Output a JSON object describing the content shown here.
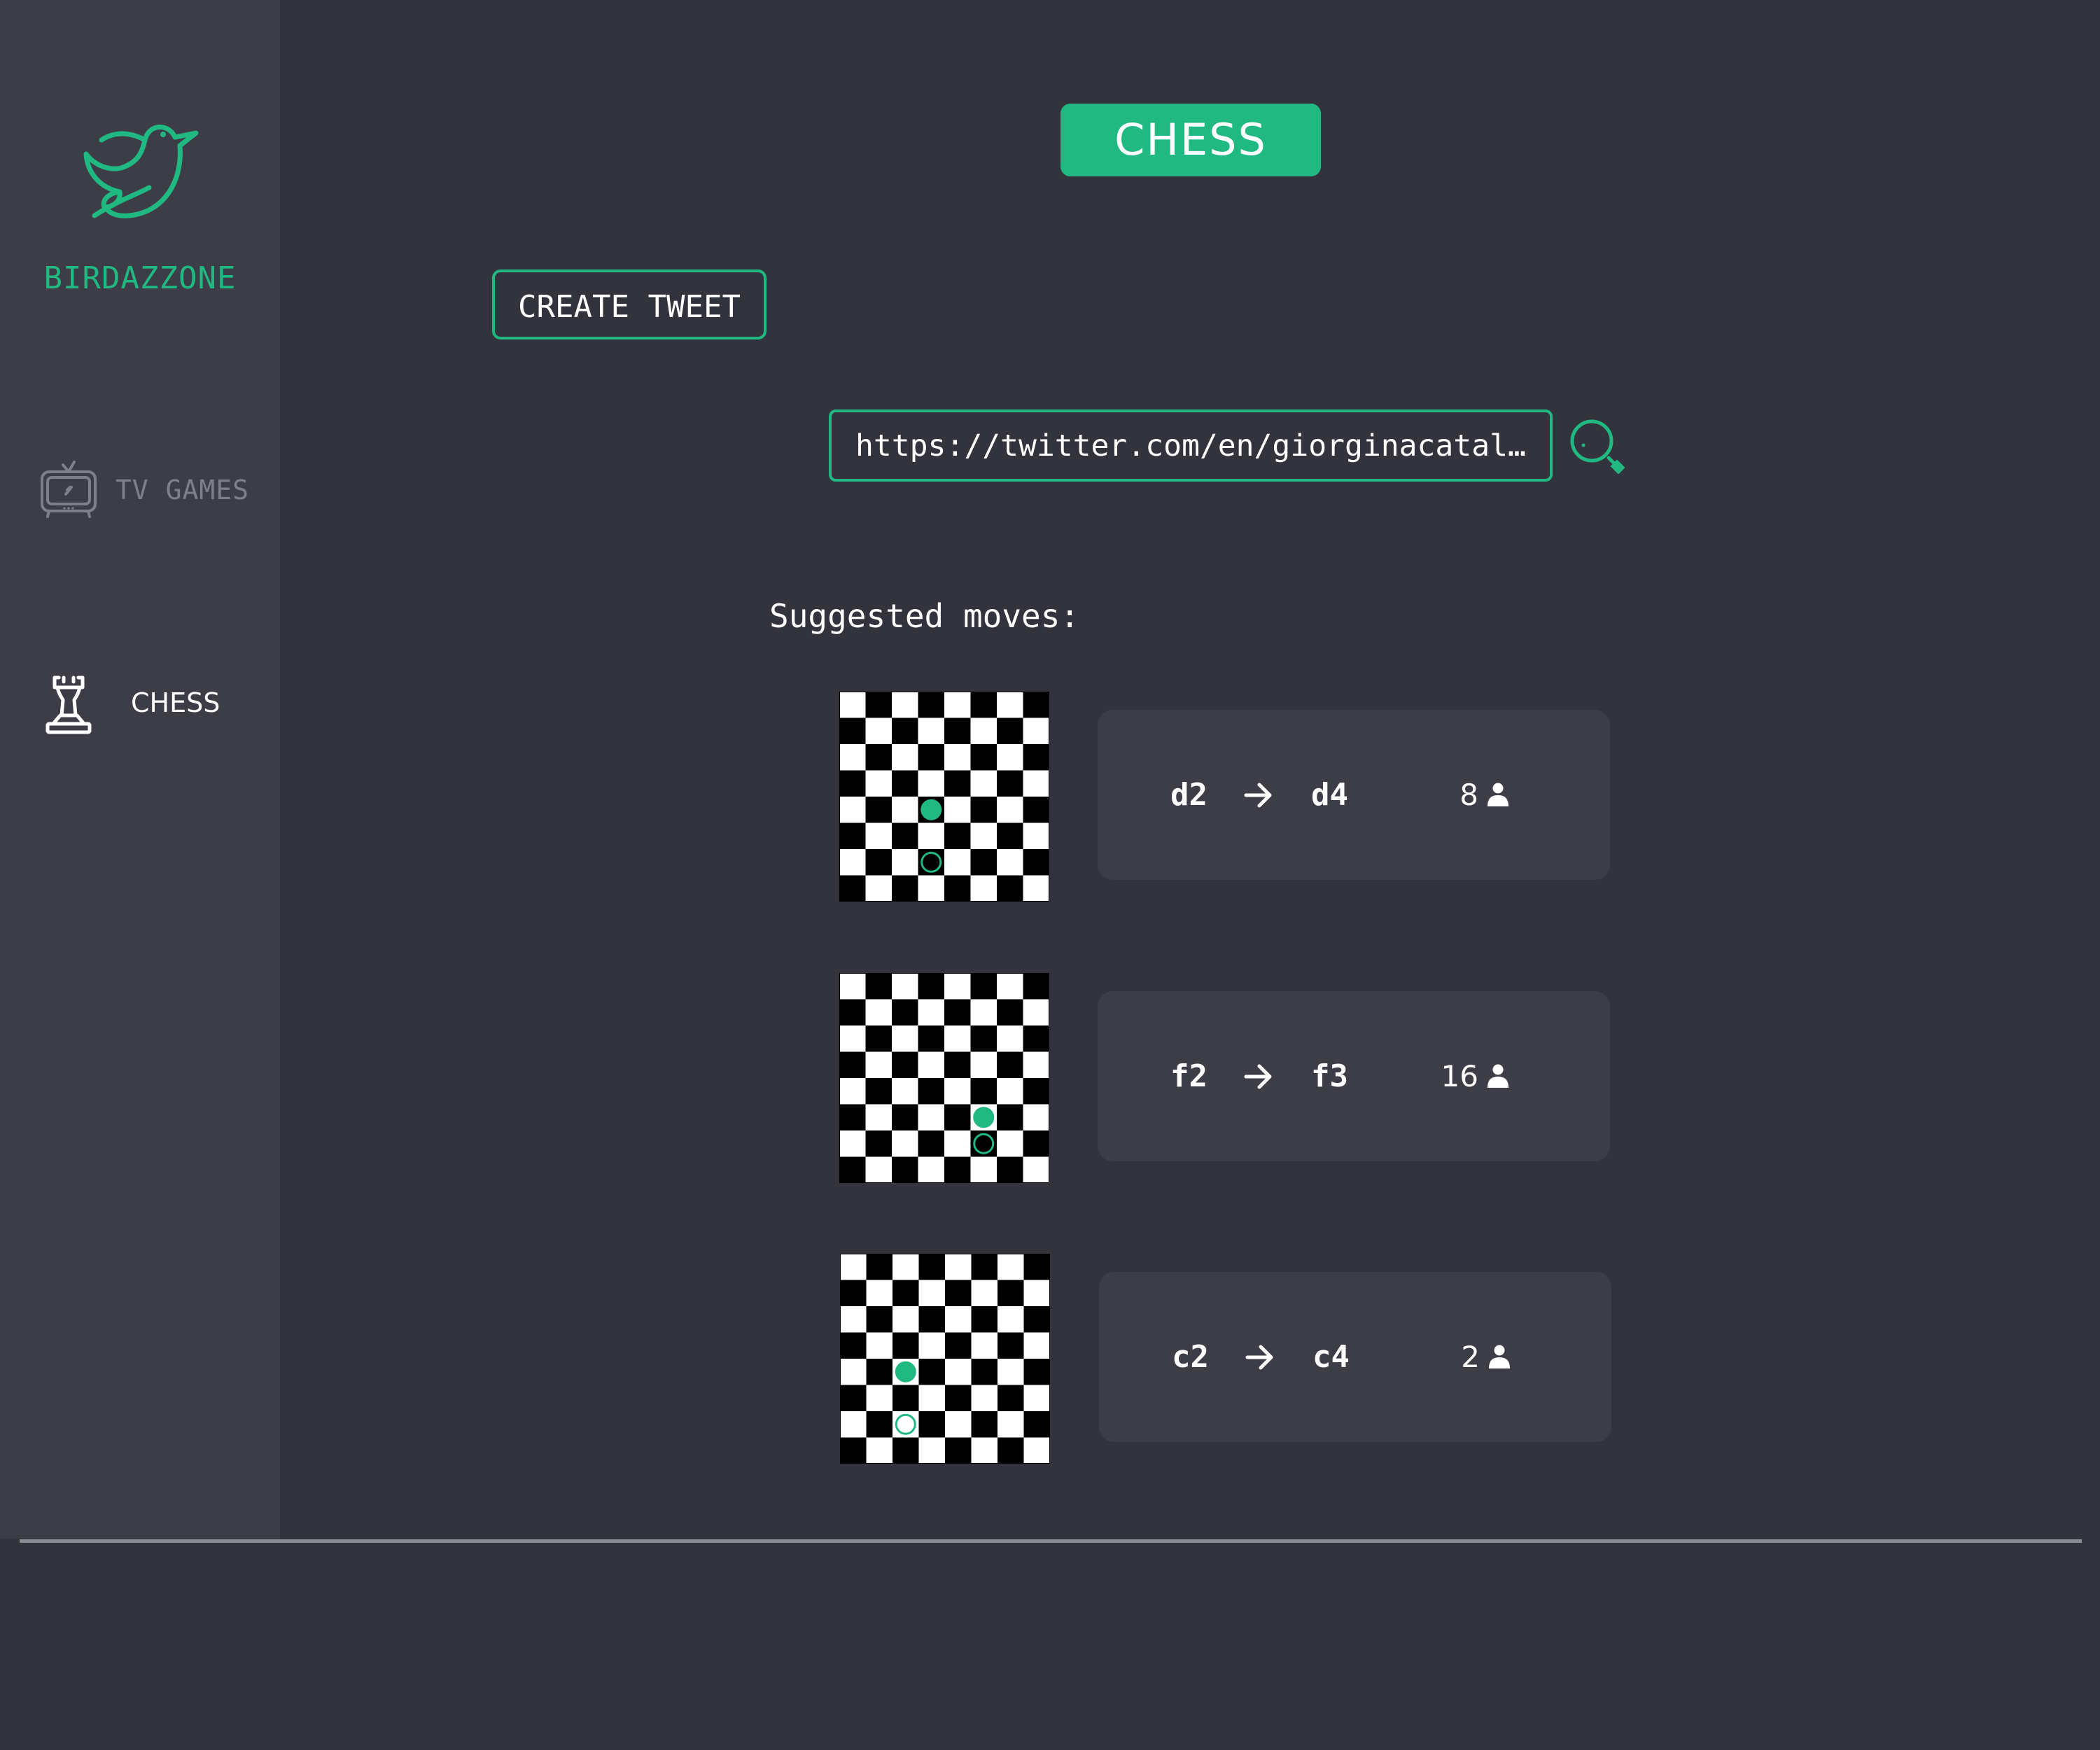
{
  "sidebar": {
    "brand": "BIRDAZZONE",
    "logo_icon": "bird-logo-icon",
    "items": [
      {
        "label": "TV GAMES",
        "icon": "tv-icon",
        "active": false
      },
      {
        "label": "CHESS",
        "icon": "rook-icon",
        "active": true
      }
    ]
  },
  "header": {
    "title": "CHESS"
  },
  "toolbar": {
    "create_tweet_label": "CREATE TWEET"
  },
  "search": {
    "value": "https://twitter.com/en/giorginacatal…",
    "icon": "search-icon"
  },
  "suggestions": {
    "title": "Suggested moves:",
    "moves": [
      {
        "from": "d2",
        "to": "d4",
        "count": "8"
      },
      {
        "from": "f2",
        "to": "f3",
        "count": "16"
      },
      {
        "from": "c2",
        "to": "c4",
        "count": "2"
      }
    ]
  },
  "colors": {
    "accent": "#1fb981",
    "background": "#32333d",
    "panel": "#3c3d47",
    "muted_text": "#7d7f8a",
    "text": "#ffffff"
  }
}
